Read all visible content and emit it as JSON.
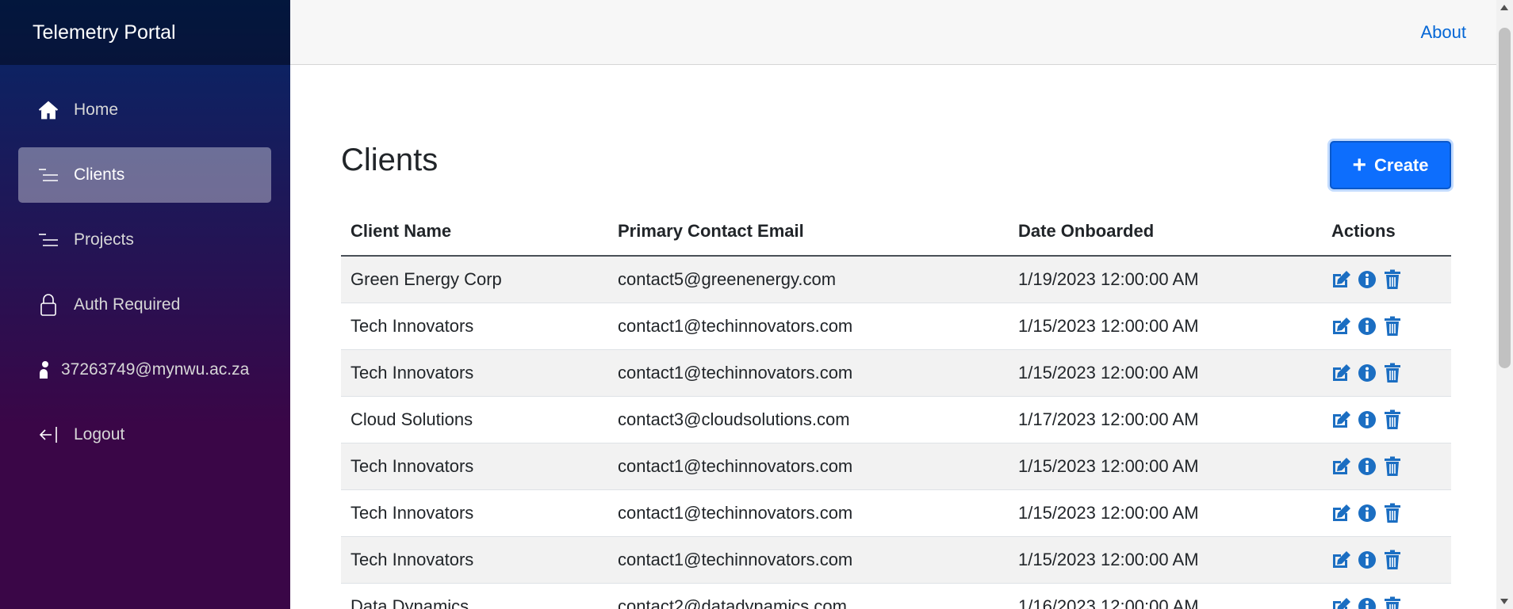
{
  "app": {
    "title": "Telemetry Portal"
  },
  "topbar": {
    "about_label": "About"
  },
  "sidebar": {
    "items": [
      {
        "label": "Home",
        "icon": "home-icon"
      },
      {
        "label": "Clients",
        "icon": "list-icon",
        "active": true
      },
      {
        "label": "Projects",
        "icon": "list-icon"
      },
      {
        "label": "Auth Required",
        "icon": "lock-icon"
      },
      {
        "label": "37263749@mynwu.ac.za",
        "icon": "person-icon"
      },
      {
        "label": "Logout",
        "icon": "logout-icon"
      }
    ]
  },
  "page": {
    "title": "Clients",
    "create_label": "Create"
  },
  "table": {
    "headers": [
      "Client Name",
      "Primary Contact Email",
      "Date Onboarded",
      "Actions"
    ],
    "rows": [
      {
        "name": "Green Energy Corp",
        "email": "contact5@greenenergy.com",
        "date": "1/19/2023 12:00:00 AM"
      },
      {
        "name": "Tech Innovators",
        "email": "contact1@techinnovators.com",
        "date": "1/15/2023 12:00:00 AM"
      },
      {
        "name": "Tech Innovators",
        "email": "contact1@techinnovators.com",
        "date": "1/15/2023 12:00:00 AM"
      },
      {
        "name": "Cloud Solutions",
        "email": "contact3@cloudsolutions.com",
        "date": "1/17/2023 12:00:00 AM"
      },
      {
        "name": "Tech Innovators",
        "email": "contact1@techinnovators.com",
        "date": "1/15/2023 12:00:00 AM"
      },
      {
        "name": "Tech Innovators",
        "email": "contact1@techinnovators.com",
        "date": "1/15/2023 12:00:00 AM"
      },
      {
        "name": "Tech Innovators",
        "email": "contact1@techinnovators.com",
        "date": "1/15/2023 12:00:00 AM"
      },
      {
        "name": "Data Dynamics",
        "email": "contact2@datadynamics.com",
        "date": "1/16/2023 12:00:00 AM"
      }
    ],
    "action_icons": [
      "edit-icon",
      "info-icon",
      "delete-icon"
    ]
  },
  "colors": {
    "accent": "#0d6efd",
    "link": "#0366d6",
    "action_icon": "#1b6ec2",
    "sidebar_top": "#052767",
    "sidebar_bottom": "#3a0647"
  }
}
